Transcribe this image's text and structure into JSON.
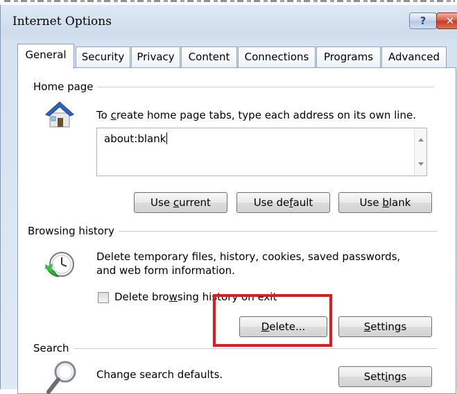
{
  "window": {
    "title": "Internet Options",
    "help_label": "?",
    "close_label": "✕"
  },
  "tabs": [
    {
      "label": "General",
      "active": true
    },
    {
      "label": "Security"
    },
    {
      "label": "Privacy"
    },
    {
      "label": "Content"
    },
    {
      "label": "Connections"
    },
    {
      "label": "Programs"
    },
    {
      "label": "Advanced"
    }
  ],
  "home_page": {
    "group_label": "Home page",
    "hint_pre": "To ",
    "hint_key": "c",
    "hint_post": "reate home page tabs, type each address on its own line.",
    "url_value": "about:blank",
    "use_current": {
      "pre": "Use ",
      "key": "c",
      "post": "urrent"
    },
    "use_default": {
      "pre": "Use de",
      "key": "f",
      "post": "ault"
    },
    "use_blank": {
      "pre": "Use ",
      "key": "b",
      "post": "lank"
    }
  },
  "browsing_history": {
    "group_label": "Browsing history",
    "desc_line1": "Delete temporary files, history, cookies, saved passwords,",
    "desc_line2": "and web form information.",
    "checkbox_pre": "Delete bro",
    "checkbox_key": "w",
    "checkbox_post": "sing history on exit",
    "checkbox_checked": false,
    "delete": {
      "key": "D",
      "post": "elete..."
    },
    "settings": {
      "key": "S",
      "post": "ettings"
    }
  },
  "search": {
    "group_label": "Search",
    "desc": "Change search defaults.",
    "settings": {
      "pre": "Sett",
      "key": "i",
      "post": "ngs"
    }
  },
  "colors": {
    "highlight": "#e51b1b",
    "panel_border": "#8ea3bd"
  },
  "icons": [
    "house-icon",
    "history-clock-icon",
    "magnifier-icon",
    "help-icon",
    "close-icon"
  ]
}
